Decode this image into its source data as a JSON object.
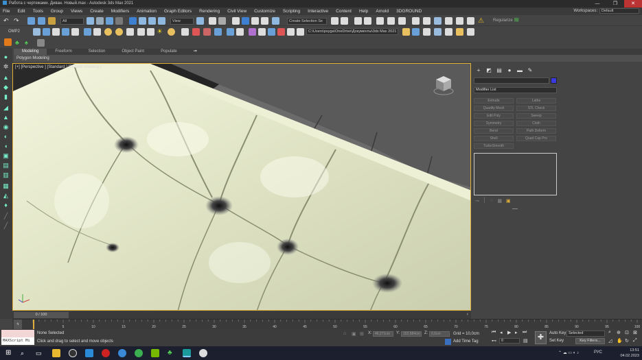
{
  "window": {
    "title": "Работа с чертежами. Диван. Новый.max - Autodesk 3ds Max 2021",
    "controls": [
      "—",
      "❐",
      "✕"
    ]
  },
  "menu": [
    "File",
    "Edit",
    "Tools",
    "Group",
    "Views",
    "Create",
    "Modifiers",
    "Animation",
    "Graph Editors",
    "Rendering",
    "Civil View",
    "Customize",
    "Scripting",
    "Interactive",
    "Content",
    "Help",
    "Arnold",
    "3DGROUND"
  ],
  "workspaces": {
    "label": "Workspaces:",
    "value": "Default"
  },
  "toolbar": {
    "filter_value": "All",
    "view_value": "View",
    "selection_set": "Create Selection Se",
    "path": "C:\\Users\\psyga\\OneDrive\\Документы\\3ds Max 2021",
    "regularize": "Regularize",
    "omp_label": "OMP2"
  },
  "ribbon": {
    "tabs": [
      "Modeling",
      "Freeform",
      "Selection",
      "Object Paint",
      "Populate"
    ],
    "active_tab": "Modeling",
    "sub_label": "Polygon Modeling"
  },
  "viewport": {
    "label": "[+] [Perspective ] [Standard ] [Default Shading ]"
  },
  "command_panel": {
    "modifier_list": "Modifier List",
    "modifier_buttons": [
      "Extrude",
      "Lathe",
      "Quadify Mesh",
      "STL Check",
      "Edit Poly",
      "Sweep",
      "Symmetry",
      "Cloth",
      "Bend",
      "Path Deform",
      "Shell",
      "Quad Cap Pro",
      "TurboSmooth"
    ]
  },
  "time_slider": {
    "position": "0 / 100",
    "current": 0,
    "max": 100
  },
  "trackbar": {
    "ticks": [
      5,
      10,
      15,
      20,
      25,
      30,
      35,
      40,
      45,
      50,
      55,
      60,
      65,
      70,
      75,
      80,
      85,
      90,
      95,
      100
    ]
  },
  "status": {
    "maxscript_label": "MAXScript Mi",
    "selection_status": "None Selected",
    "prompt": "Click and drag to select and move objects",
    "x_label": "X:",
    "x_value": "46,271cm",
    "y_label": "Y:",
    "y_value": "152,684cm",
    "z_label": "Z:",
    "z_value": "0,0cm",
    "grid": "Grid = 10,0cm",
    "add_time_tag": "Add Time Tag",
    "auto_key": "Auto Key",
    "set_key": "Set Key",
    "selected": "Selected",
    "key_filters": "Key Filters...",
    "frame": "0"
  },
  "taskbar": {
    "time": "13:51",
    "date": "04.02.2023",
    "lang": "РУС"
  }
}
